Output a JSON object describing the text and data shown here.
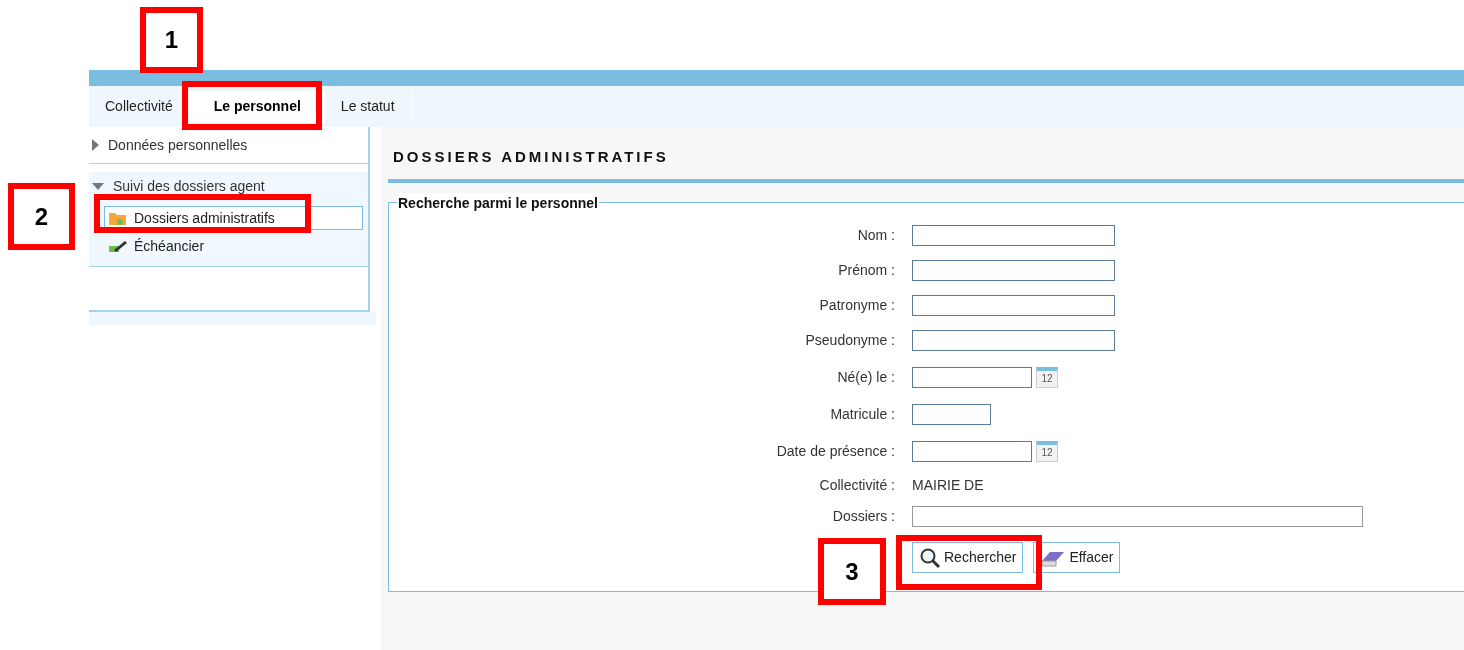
{
  "tabs": [
    {
      "label": "Collectivité",
      "selected": false
    },
    {
      "label": "Le personnel",
      "selected": true
    },
    {
      "label": "Le statut",
      "selected": false
    }
  ],
  "sidebar": {
    "sections": [
      {
        "label": "Données personnelles",
        "expanded": false
      },
      {
        "label": "Suivi des dossiers agent",
        "expanded": true,
        "children": [
          {
            "label": "Dossiers administratifs",
            "selected": true
          },
          {
            "label": "Échéancier",
            "selected": false
          }
        ]
      }
    ]
  },
  "page_title": "DOSSIERS ADMINISTRATIFS",
  "form": {
    "legend": "Recherche parmi le personnel",
    "fields": [
      {
        "label": "Nom :",
        "kind": "text"
      },
      {
        "label": "Prénom :",
        "kind": "text"
      },
      {
        "label": "Patronyme :",
        "kind": "text"
      },
      {
        "label": "Pseudonyme :",
        "kind": "text"
      },
      {
        "label": "Né(e) le :",
        "kind": "date",
        "calendar_day": "12"
      },
      {
        "label": "Matricule :",
        "kind": "short"
      },
      {
        "label": "Date de présence :",
        "kind": "date",
        "calendar_day": "12"
      },
      {
        "label": "Collectivité :",
        "kind": "static",
        "value": "MAIRIE DE"
      },
      {
        "label": "Dossiers :",
        "kind": "wide"
      }
    ],
    "buttons": [
      {
        "label": "Rechercher",
        "kind": "search"
      },
      {
        "label": "Effacer",
        "kind": "clear"
      }
    ]
  },
  "annotations": [
    {
      "label": "1"
    },
    {
      "label": "2"
    },
    {
      "label": "3"
    }
  ]
}
